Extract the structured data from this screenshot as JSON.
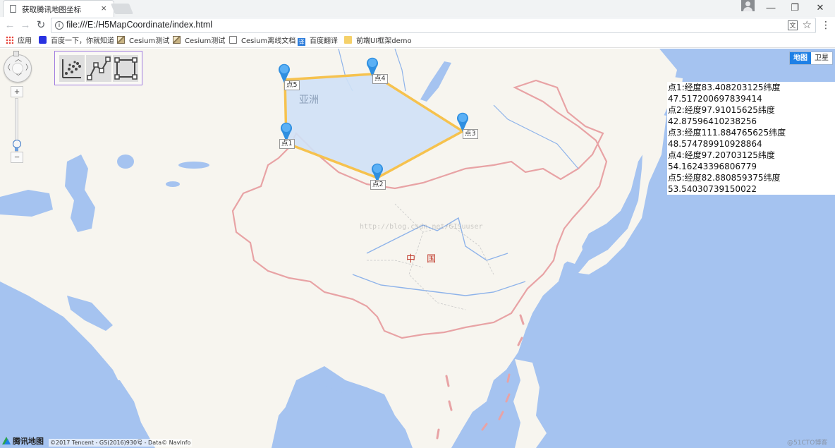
{
  "window": {
    "tab_title": "获取腾讯地图坐标",
    "tab_close": "×",
    "minimize": "—",
    "maximize": "❐",
    "close": "✕"
  },
  "toolbar": {
    "back": "←",
    "forward": "→",
    "reload": "↻",
    "info": "i",
    "url": "file:///E:/H5MapCoordinate/index.html",
    "translate": "文",
    "star": "☆",
    "menu": "⋮"
  },
  "bookmarks": [
    {
      "label": "应用",
      "icon": "apps-grid-icon"
    },
    {
      "label": "百度一下，你就知道",
      "icon": "baidu-paw-icon"
    },
    {
      "label": "Cesium测试",
      "icon": "image-icon"
    },
    {
      "label": "Cesium测试",
      "icon": "image-icon"
    },
    {
      "label": "Cesium离线文档",
      "icon": "document-icon"
    },
    {
      "label": "百度翻译",
      "icon": "translate-icon"
    },
    {
      "label": "前端UI框架demo",
      "icon": "folder-icon"
    }
  ],
  "map": {
    "continent_label": "亚洲",
    "country_label": "中 国",
    "map_type": {
      "map": "地图",
      "satellite": "卫星",
      "active": "map"
    },
    "zoom": {
      "plus": "+",
      "minus": "−",
      "level_fraction": 0.14
    },
    "pan_arrows": {
      "up": "︿",
      "down": "﹀",
      "left": "〈",
      "right": "〉"
    },
    "compass": "⊡",
    "tools": [
      "marker-tool-icon",
      "polyline-tool-icon",
      "rectangle-tool-icon"
    ],
    "polygon": {
      "stroke": "#f6c24e",
      "fill": "#cfe1f6"
    },
    "markers": [
      {
        "label": "点1"
      },
      {
        "label": "点2"
      },
      {
        "label": "点3"
      },
      {
        "label": "点4"
      },
      {
        "label": "点5"
      }
    ],
    "brand": "腾讯地图",
    "copyright": "©2017 Tencent - GS(2016)930号 - Data© NavInfo",
    "watermark_url": "http://blog.csdn.net/GISuuser",
    "watermark_corner": "@51CTO博客"
  },
  "coords_panel": [
    "点1:经度83.408203125纬度",
    "47.517200697839414",
    "点2:经度97.91015625纬度",
    "42.87596410238256",
    "点3:经度111.884765625纬度",
    "48.574789910928864",
    "点4:经度97.20703125纬度",
    "54.16243396806779",
    "点5:经度82.880859375纬度",
    "53.54030739150022"
  ],
  "colors": {
    "water": "#a5c3f0",
    "land": "#f7f5ef",
    "border": "#e8a3a5",
    "omnibox_highlight": "#d8ecd6",
    "accent": "#1e80e6"
  }
}
